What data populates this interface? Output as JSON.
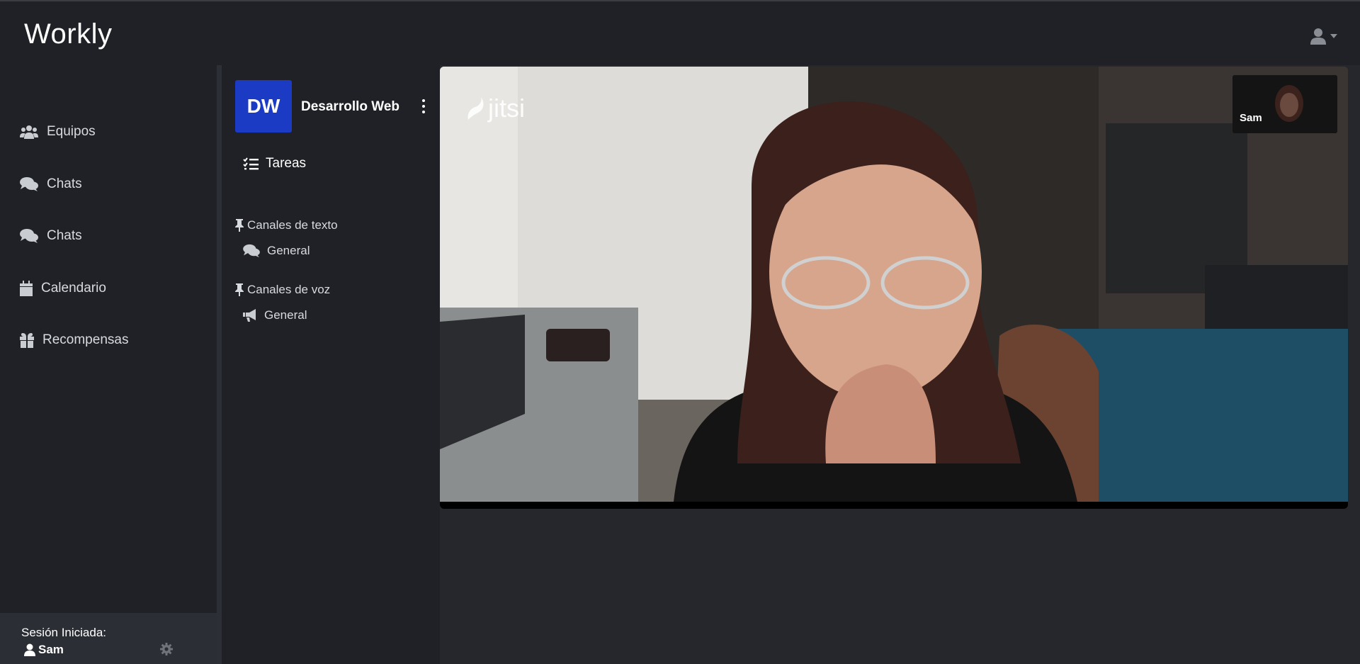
{
  "app": {
    "title": "Workly"
  },
  "sidebar": {
    "items": [
      {
        "label": "Equipos",
        "icon": "users-icon"
      },
      {
        "label": "Chats",
        "icon": "comments-icon"
      },
      {
        "label": "Chats",
        "icon": "comments-icon"
      },
      {
        "label": "Calendario",
        "icon": "calendar-icon"
      },
      {
        "label": "Recompensas",
        "icon": "gift-icon"
      }
    ],
    "session": {
      "label": "Sesión Iniciada:",
      "user": "Sam"
    }
  },
  "team": {
    "initials": "DW",
    "name": "Desarrollo Web",
    "color": "#1c3bc4",
    "tasks_label": "Tareas",
    "text_section": "Canales de texto",
    "text_channels": [
      "General"
    ],
    "voice_section": "Canales de voz",
    "voice_channels": [
      "General"
    ]
  },
  "video": {
    "provider": "jitsi",
    "participant": "Sam"
  },
  "colors": {
    "background": "#1f2126",
    "panel": "#2b2e35",
    "accent": "#1c3bc4"
  }
}
